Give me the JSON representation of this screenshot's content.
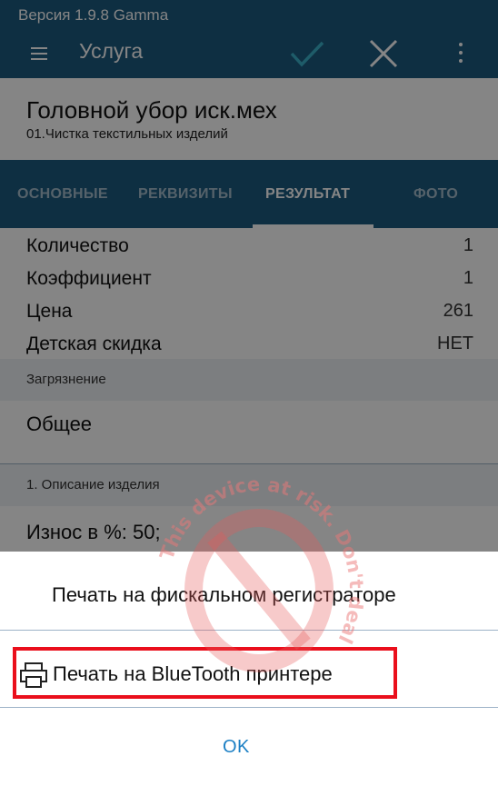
{
  "status_bar": {
    "version": "Версия 1.9.8 Gamma"
  },
  "app_bar": {
    "title": "Услуга"
  },
  "header": {
    "title": "Головной убор иск.мех",
    "subtitle": "01.Чистка текстильных изделий"
  },
  "tabs": [
    {
      "label": "ОСНОВНЫЕ"
    },
    {
      "label": "РЕКВИЗИТЫ"
    },
    {
      "label": "РЕЗУЛЬТАТ"
    },
    {
      "label": "ФОТО"
    }
  ],
  "active_tab": "РЕЗУЛЬТАТ",
  "rows": [
    {
      "label": "Количество",
      "value": "1"
    },
    {
      "label": "Коэффициент",
      "value": "1"
    },
    {
      "label": "Цена",
      "value": "261"
    },
    {
      "label": "Детская скидка",
      "value": "НЕТ"
    }
  ],
  "sections": {
    "contamination": {
      "label": "Загрязнение",
      "value": "Общее"
    },
    "description": {
      "label": "1. Описание изделия",
      "value": "Износ в %: 50;"
    }
  },
  "sheet": {
    "option_fiscal": "Печать на фискальном регистраторе",
    "option_bluetooth": "Печать на BlueTooth принтере",
    "ok": "OK"
  },
  "watermark": {
    "text": "This device at risk. Don't deal"
  },
  "colors": {
    "primary": "#1c5a7f",
    "accent_check": "#3ab0c9",
    "highlight": "#ea0f1c",
    "ok_text": "#1b7fc4"
  }
}
